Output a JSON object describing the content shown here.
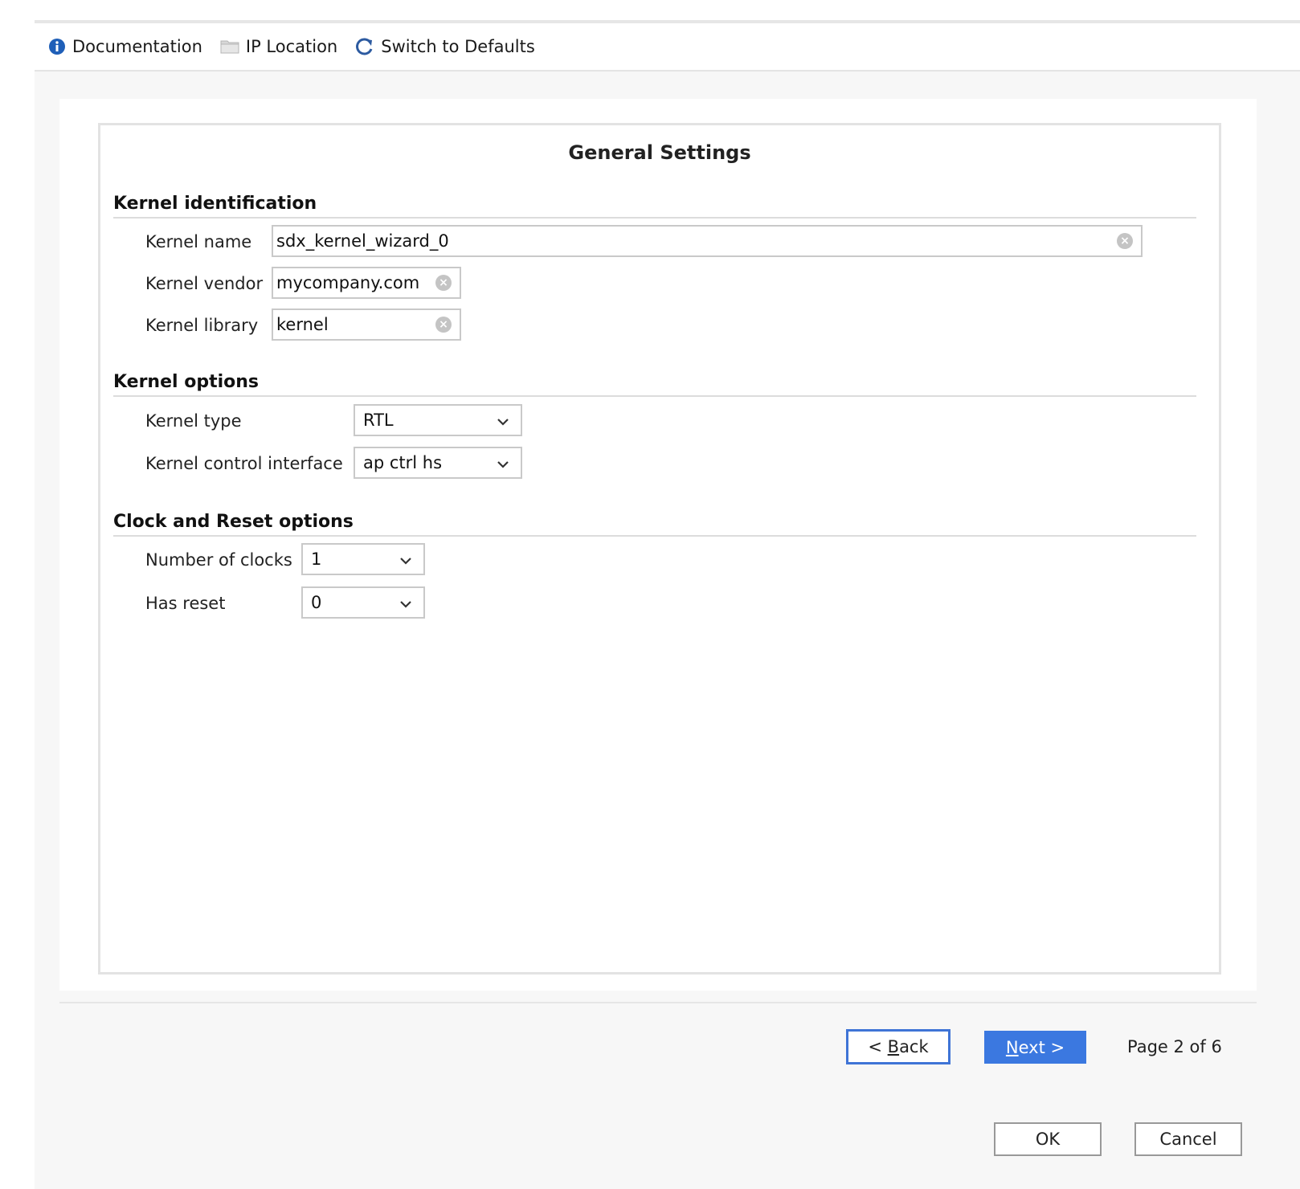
{
  "toolbar": {
    "documentation_label": "Documentation",
    "ip_location_label": "IP Location",
    "switch_defaults_label": "Switch to Defaults"
  },
  "panel": {
    "title": "General Settings"
  },
  "kernel_identification": {
    "title": "Kernel identification",
    "name_label": "Kernel name",
    "name_value": "sdx_kernel_wizard_0",
    "vendor_label": "Kernel vendor",
    "vendor_value": "mycompany.com",
    "library_label": "Kernel library",
    "library_value": "kernel"
  },
  "kernel_options": {
    "title": "Kernel options",
    "type_label": "Kernel type",
    "type_value": "RTL",
    "control_label": "Kernel control interface",
    "control_value": "ap ctrl hs"
  },
  "clock_reset": {
    "title": "Clock and Reset options",
    "clocks_label": "Number of clocks",
    "clocks_value": "1",
    "reset_label": "Has reset",
    "reset_value": "0"
  },
  "nav": {
    "back_prefix": "< ",
    "back_mnemonic": "B",
    "back_rest": "ack",
    "next_mnemonic": "N",
    "next_rest": "ext >",
    "page_info": "Page 2 of 6"
  },
  "actions": {
    "ok_label": "OK",
    "cancel_label": "Cancel"
  },
  "colors": {
    "accent": "#3b78e0",
    "info_icon": "#1f5fb8",
    "border": "#c9c9c9"
  }
}
